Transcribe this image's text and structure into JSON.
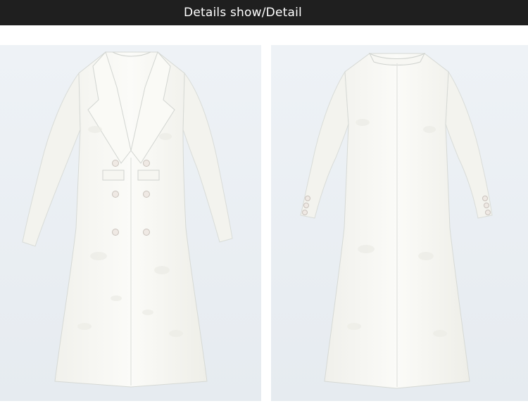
{
  "header": {
    "title": "Details show/Detail"
  },
  "photos": [
    {
      "view": "front",
      "subject": "white-jacquard-double-breasted-long-coat"
    },
    {
      "view": "back",
      "subject": "white-jacquard-double-breasted-long-coat"
    }
  ],
  "colors": {
    "header_bg": "#1f1f1f",
    "header_text": "#ffffff",
    "photo_bg": "#e9eef3",
    "coat": "#f8f8f4"
  }
}
